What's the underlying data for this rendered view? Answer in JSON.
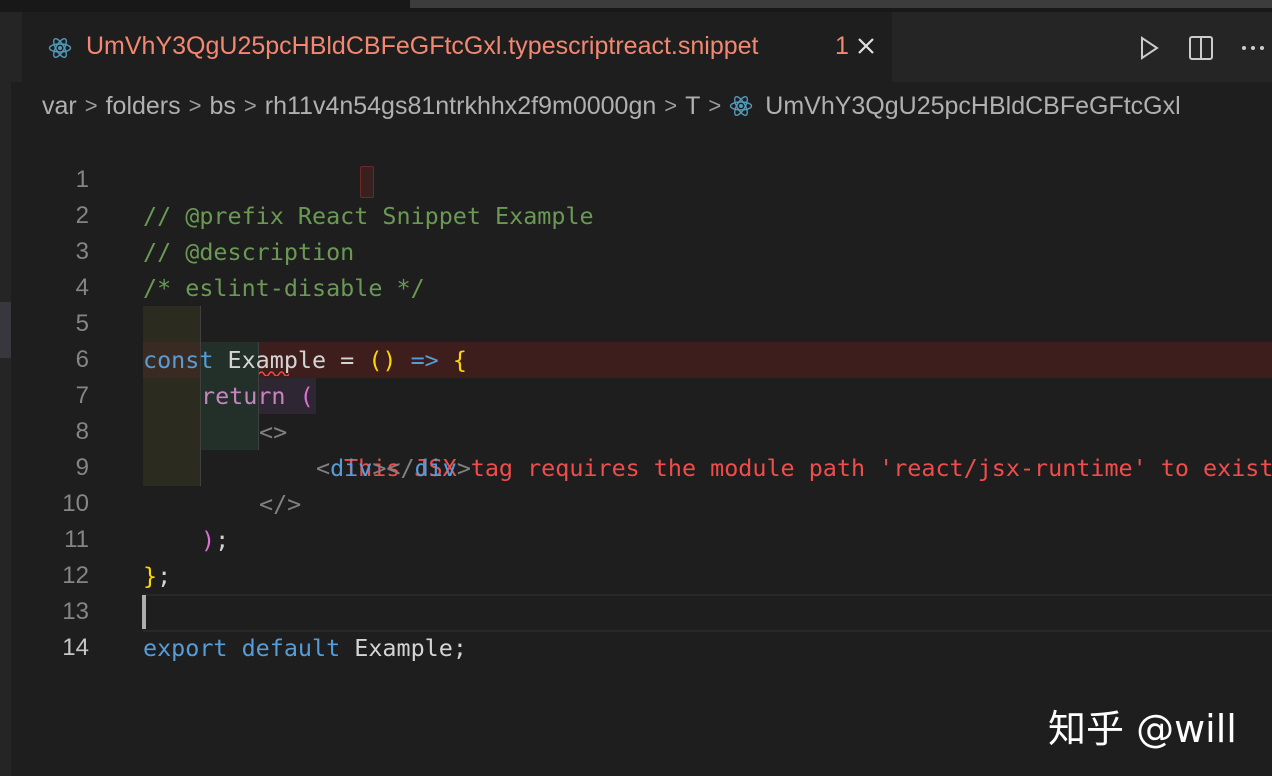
{
  "tab": {
    "title": "UmVhY3QgU25pcHBldCBFeGFtcGxl.typescriptreact.snippet",
    "problem_count": "1"
  },
  "actions": [
    "run-icon",
    "split-editor-icon",
    "more-actions-icon"
  ],
  "breadcrumb": [
    "var",
    "folders",
    "bs",
    "rh11v4n54gs81ntrkhhx2f9m0000gn",
    "T",
    "UmVhY3QgU25pcHBldCBFeGFtcGxl"
  ],
  "editor": {
    "line_numbers": [
      "1",
      "2",
      "3",
      "4",
      "5",
      "6",
      "7",
      "8",
      "9",
      "10",
      "11",
      "12",
      "13",
      "14"
    ],
    "active_line": "14",
    "lines": {
      "l1": "// @prefix React Snippet Example",
      "l2": "// @description",
      "l3": "/* eslint-disable */",
      "l5_kw": "const",
      "l5_id": " Example = ",
      "l5_paren": "()",
      "l5_arrow": " => ",
      "l5_brace": "{",
      "l6_kw": "return",
      "l6_paren": " (",
      "l7_tag": "<>",
      "l7_error": "This JSX tag requires the module path 'react/jsx-runtime' to exist",
      "l8_open": "<",
      "l8_tag1": "div",
      "l8_mid": "></",
      "l8_tag2": "div",
      "l8_close": ">",
      "l9_tag": "</>",
      "l10_paren": ")",
      "l10_semi": ";",
      "l11_brace": "}",
      "l11_semi": ";",
      "l13_kw1": "export",
      "l13_kw2": " default",
      "l13_id": " Example;"
    }
  },
  "colors": {
    "tab_error": "#f48771",
    "comment": "#6a9955",
    "keyword": "#569cd6",
    "control": "#c586c0",
    "error": "#f14c4c",
    "bracket_gold": "#ffd700",
    "bracket_orchid": "#da70d6"
  },
  "watermark": "知乎 @will"
}
